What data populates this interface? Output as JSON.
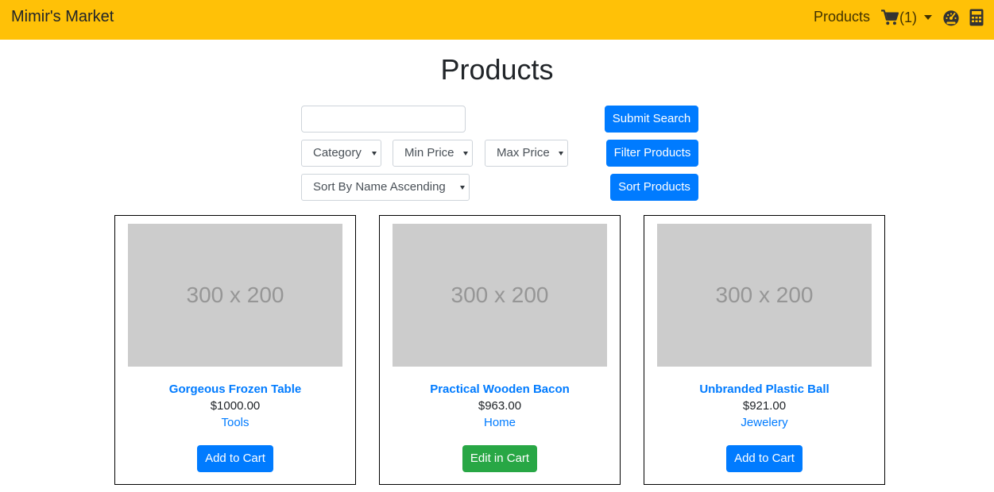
{
  "navbar": {
    "brand": "Mimir's Market",
    "products_link": "Products",
    "cart_count": "(1)",
    "icons": [
      "cart-icon",
      "tachometer-icon",
      "calculator-icon"
    ]
  },
  "page": {
    "title": "Products"
  },
  "filters": {
    "search_value": "",
    "search_placeholder": "",
    "category_selected": "Category",
    "min_price_selected": "Min Price",
    "max_price_selected": "Max Price",
    "sort_selected": "Sort By Name Ascending",
    "submit_search_label": "Submit Search",
    "filter_products_label": "Filter Products",
    "sort_products_label": "Sort Products"
  },
  "products": [
    {
      "image_text": "300 x 200",
      "name": "Gorgeous Frozen Table",
      "price": "$1000.00",
      "category": "Tools",
      "button_label": "Add to Cart"
    },
    {
      "image_text": "300 x 200",
      "name": "Practical Wooden Bacon",
      "price": "$963.00",
      "category": "Home",
      "button_label": "Edit in Cart"
    },
    {
      "image_text": "300 x 200",
      "name": "Unbranded Plastic Ball",
      "price": "$921.00",
      "category": "Jewelery",
      "button_label": "Add to Cart"
    }
  ],
  "colors": {
    "navbar_bg": "#ffc107",
    "primary": "#007bff",
    "success": "#28a745",
    "placeholder_bg": "#cccccc"
  }
}
